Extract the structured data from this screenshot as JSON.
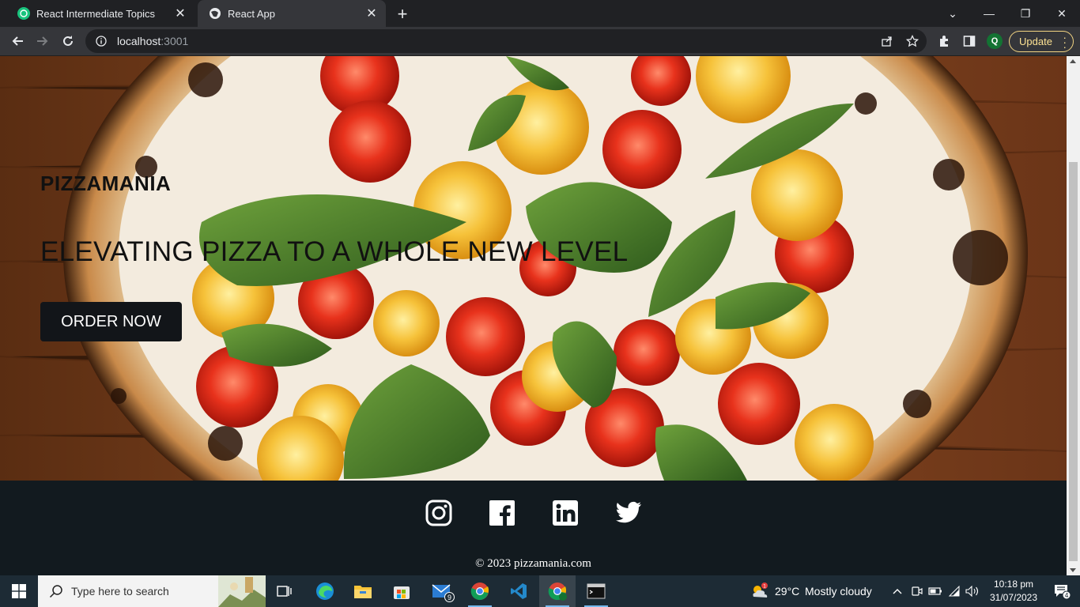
{
  "browser": {
    "tabs": [
      {
        "title": "React Intermediate Topics",
        "active": false
      },
      {
        "title": "React App",
        "active": true
      }
    ],
    "address": {
      "host": "localhost",
      "port": ":3001"
    },
    "update_label": "Update",
    "profile_initial": "Q",
    "accent_update": "#fde293"
  },
  "page": {
    "hero": {
      "brand": "PIZZAMANIA",
      "tagline": "ELEVATING PIZZA TO A WHOLE NEW LEVEL",
      "cta_label": "ORDER NOW"
    },
    "footer": {
      "social_icons": [
        "instagram-icon",
        "facebook-icon",
        "linkedin-icon",
        "twitter-icon"
      ],
      "copyright": "© 2023 pizzamania.com"
    }
  },
  "taskbar": {
    "search_placeholder": "Type here to search",
    "apps": [
      "task-view-icon",
      "edge-icon",
      "file-explorer-icon",
      "microsoft-store-icon",
      "mail-icon",
      "chrome-icon",
      "vscode-icon",
      "chrome-profile-icon",
      "terminal-icon"
    ],
    "mail_badge": "9",
    "weather": {
      "temp": "29°C",
      "condition": "Mostly cloudy",
      "alert_count": "1"
    },
    "time": "10:18 pm",
    "date": "31/07/2023",
    "notification_count": "4"
  }
}
